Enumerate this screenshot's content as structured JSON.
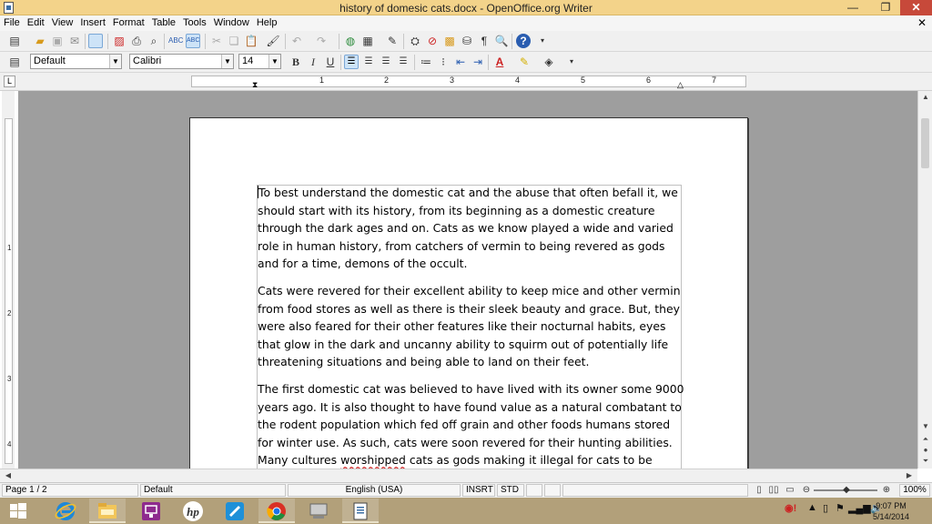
{
  "window": {
    "title": "history of domesic cats.docx - OpenOffice.org Writer",
    "controls": {
      "minimize": "—",
      "maximize": "❐",
      "close": "✕"
    }
  },
  "menu": {
    "items": [
      "File",
      "Edit",
      "View",
      "Insert",
      "Format",
      "Table",
      "Tools",
      "Window",
      "Help"
    ],
    "close_doc": "✕"
  },
  "formatting": {
    "paragraph_style": "Default",
    "font_name": "Calibri",
    "font_size": "14",
    "bold": "B",
    "italic": "I",
    "underline": "U"
  },
  "ruler": {
    "marks": [
      "1",
      "2",
      "3",
      "4",
      "5",
      "6",
      "7"
    ],
    "vertical_marks": [
      "1",
      "2",
      "3",
      "4"
    ]
  },
  "document": {
    "paragraphs": [
      "To best understand the domestic cat and the abuse that often befall it, we should start with its history, from its beginning as a domestic creature through the dark ages and on. Cats as we know played a wide and varied role in human history, from catchers of vermin to being revered as gods and for a time, demons of the occult.",
      "Cats were revered for their excellent ability to keep mice and other vermin from food stores as well as there is their sleek beauty and grace. But, they were also feared for their other features like their nocturnal habits, eyes that glow in the dark and uncanny ability to squirm out of potentially life threatening situations and being able to land on their feet.",
      "The first domestic cat was believed to have lived with its owner some 9000 years ago.  It is also thought to have found value as a natural combatant to the rodent population which fed off grain and other foods humans stored for winter use. As such, cats were soon revered for their hunting abilities. Many cultures"
    ],
    "spellcheck_word": "worshipped",
    "para3_tail": "cats as gods making it illegal for cats to be harmed or even exported.  Cats were"
  },
  "status": {
    "page": "Page 1 / 2",
    "style": "Default",
    "language": "English (USA)",
    "insert_mode": "INSRT",
    "selection_mode": "STD",
    "zoom": "100%"
  },
  "taskbar": {
    "apps": [
      "windows-logo",
      "internet-explorer",
      "file-explorer",
      "presentation-app",
      "hp-app",
      "ticket-app",
      "chrome",
      "network-app",
      "openoffice-writer"
    ],
    "time": "9:07 PM",
    "date": "5/14/2014"
  },
  "colors": {
    "titlebar": "#f3d38a",
    "close_button": "#c7493a",
    "workarea": "#9e9e9e",
    "taskbar": "#b2a07a",
    "spell_underline": "#d02020"
  }
}
